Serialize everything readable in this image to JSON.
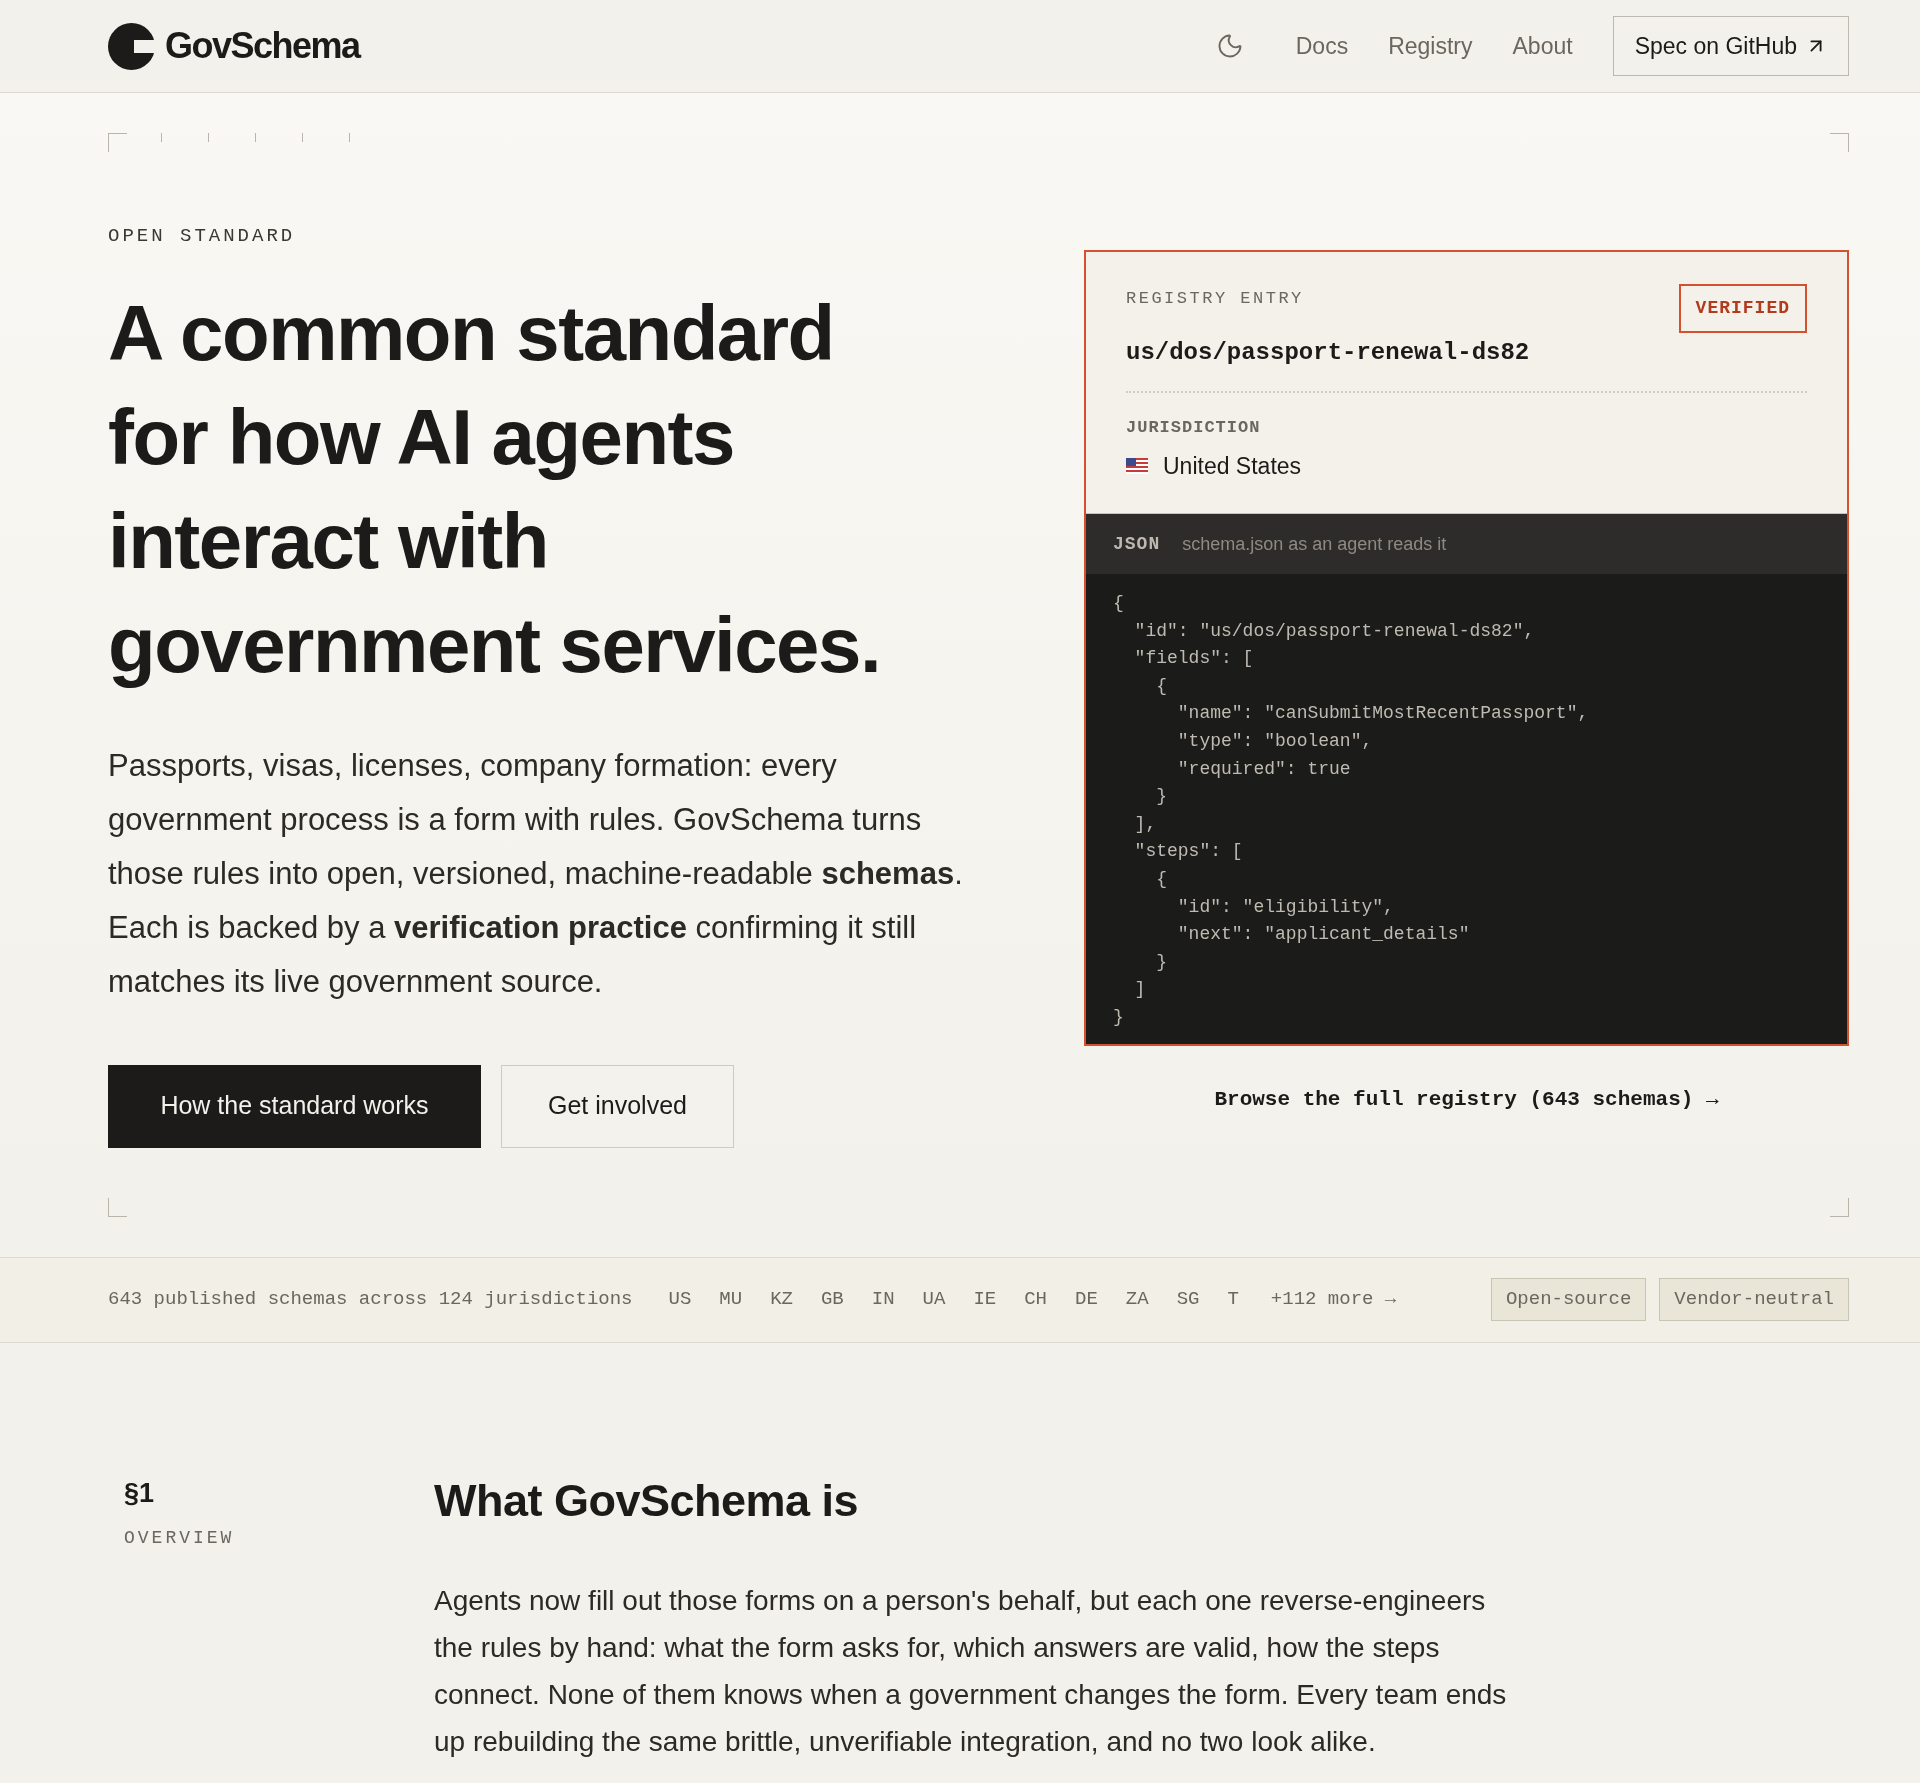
{
  "header": {
    "logo": "GovSchema",
    "nav": [
      "Docs",
      "Registry",
      "About"
    ],
    "cta": "Spec on GitHub"
  },
  "hero": {
    "eyebrow": "OPEN STANDARD",
    "title": "A common standard for how AI agents interact with government services.",
    "body": "Passports, visas, licenses, company formation: every government process is a form with rules. GovSchema turns those rules into open, versioned, machine-readable **schemas**. Each is backed by a **verification practice** confirming it still matches its live government source.",
    "primary_button": "How the standard works",
    "secondary_button": "Get involved"
  },
  "registry_card": {
    "label": "REGISTRY ENTRY",
    "badge": "VERIFIED",
    "path": "us/dos/passport-renewal-ds82",
    "jurisdiction_label": "JURISDICTION",
    "jurisdiction": "United States",
    "code_tab": "JSON",
    "code_caption": "schema.json as an agent reads it",
    "code_lines": [
      "{",
      "  \"id\": \"us/dos/passport-renewal-ds82\",",
      "  \"fields\": [",
      "    {",
      "      \"name\": \"canSubmitMostRecentPassport\",",
      "      \"type\": \"boolean\",",
      "      \"required\": true",
      "    }",
      "  ],",
      "  \"steps\": [",
      "    {",
      "      \"id\": \"eligibility\",",
      "      \"next\": \"applicant_details\"",
      "    }",
      "  ]",
      "}"
    ],
    "browse_link": "Browse the full registry (643 schemas) →"
  },
  "stats_bar": {
    "summary": "643 published schemas across 124 jurisdictions",
    "jurisdictions": [
      "US",
      "MU",
      "KZ",
      "GB",
      "IN",
      "UA",
      "IE",
      "CH",
      "DE",
      "ZA",
      "SG",
      "T"
    ],
    "more": "+112 more →",
    "tags": [
      "Open-source",
      "Vendor-neutral"
    ]
  },
  "section": {
    "number": "§1",
    "label": "OVERVIEW",
    "heading": "What GovSchema is",
    "body": "Agents now fill out those forms on a person's behalf, but each one reverse-engineers the rules by hand: what the form asks for, which answers are valid, how the steps connect. None of them knows when a government changes the form. Every team ends up rebuilding the same brittle, unverifiable integration, and no two look alike."
  }
}
